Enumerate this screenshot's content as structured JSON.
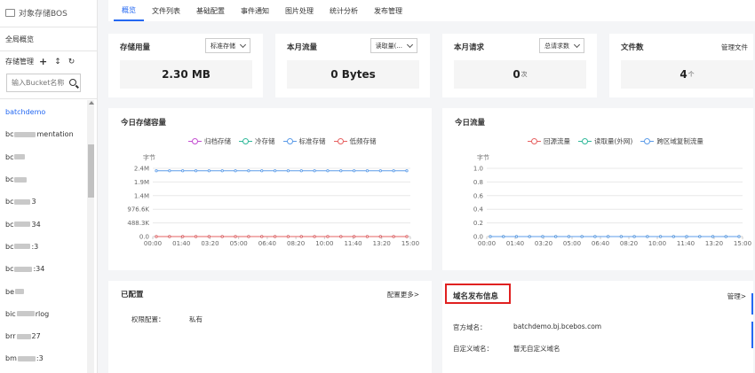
{
  "sidebar": {
    "title": "对象存储BOS",
    "overview": "全局概览",
    "manage_label": "存储管理",
    "tool_add": "+",
    "tool_sort": "↕",
    "tool_refresh": "↻",
    "search_placeholder": "输入Bucket名称",
    "buckets": [
      "batchdemo",
      "bc",
      "mentation",
      "bc",
      "bc",
      "bc",
      "3",
      "bc",
      "34",
      "bc",
      ":3",
      "bc",
      ":34",
      "be",
      "bic",
      "rlog",
      "brr",
      "27",
      "bm",
      ":3"
    ]
  },
  "tabs": [
    "概览",
    "文件列表",
    "基础配置",
    "事件通知",
    "图片处理",
    "统计分析",
    "发布管理"
  ],
  "cards": {
    "storage": {
      "title": "存储用量",
      "select": "标准存储",
      "value": "2.30 MB"
    },
    "traffic": {
      "title": "本月流量",
      "select": "读取量(...",
      "value": "0 Bytes"
    },
    "requests": {
      "title": "本月请求",
      "select": "总请求数",
      "value": "0",
      "unit": "次"
    },
    "files": {
      "title": "文件数",
      "link": "管理文件",
      "value": "4",
      "unit": "个"
    }
  },
  "storage_chart": {
    "title": "今日存储容量",
    "legend": [
      "归档存储",
      "冷存储",
      "标准存储",
      "低频存储"
    ],
    "legend_colors": [
      "#c44dd1",
      "#2fb89a",
      "#5b9be8",
      "#e66060"
    ],
    "unit_label": "字节"
  },
  "traffic_chart": {
    "title": "今日流量",
    "legend": [
      "回源流量",
      "读取量(外网)",
      "跨区域复制流量"
    ],
    "legend_colors": [
      "#e66060",
      "#2fb89a",
      "#5b9be8"
    ],
    "unit_label": "字节"
  },
  "chart_data": [
    {
      "type": "line",
      "title": "今日存储容量",
      "ylabel": "字节",
      "x": [
        "00:00",
        "01:40",
        "03:20",
        "05:00",
        "06:40",
        "08:20",
        "10:00",
        "11:40",
        "13:20",
        "15:00"
      ],
      "y_ticks": [
        "0.0",
        "488.3K",
        "976.6K",
        "1.4M",
        "1.9M",
        "2.4M"
      ],
      "ylim": [
        0,
        2500000
      ],
      "series": [
        {
          "name": "归档存储",
          "color": "#c44dd1",
          "values": [
            0,
            0,
            0,
            0,
            0,
            0,
            0,
            0,
            0,
            0,
            0,
            0,
            0,
            0,
            0,
            0,
            0,
            0,
            0,
            0
          ]
        },
        {
          "name": "冷存储",
          "color": "#2fb89a",
          "values": [
            0,
            0,
            0,
            0,
            0,
            0,
            0,
            0,
            0,
            0,
            0,
            0,
            0,
            0,
            0,
            0,
            0,
            0,
            0,
            0
          ]
        },
        {
          "name": "标准存储",
          "color": "#5b9be8",
          "values": [
            2410000,
            2410000,
            2410000,
            2410000,
            2410000,
            2410000,
            2410000,
            2410000,
            2410000,
            2410000,
            2410000,
            2410000,
            2410000,
            2410000,
            2410000,
            2410000,
            2410000,
            2410000,
            2410000,
            2410000
          ]
        },
        {
          "name": "低频存储",
          "color": "#e66060",
          "values": [
            0,
            0,
            0,
            0,
            0,
            0,
            0,
            0,
            0,
            0,
            0,
            0,
            0,
            0,
            0,
            0,
            0,
            0,
            0,
            0
          ]
        }
      ],
      "grid": true,
      "legend": "top-center"
    },
    {
      "type": "line",
      "title": "今日流量",
      "ylabel": "字节",
      "x": [
        "00:00",
        "01:40",
        "03:20",
        "05:00",
        "06:40",
        "08:20",
        "10:00",
        "11:40",
        "13:20",
        "15:00"
      ],
      "y_ticks": [
        "0.0",
        "0.2",
        "0.4",
        "0.6",
        "0.8",
        "1.0"
      ],
      "ylim": [
        0,
        1
      ],
      "series": [
        {
          "name": "回源流量",
          "color": "#e66060",
          "values": [
            0,
            0,
            0,
            0,
            0,
            0,
            0,
            0,
            0,
            0,
            0,
            0,
            0,
            0,
            0,
            0,
            0,
            0,
            0,
            0
          ]
        },
        {
          "name": "读取量(外网)",
          "color": "#2fb89a",
          "values": [
            0,
            0,
            0,
            0,
            0,
            0,
            0,
            0,
            0,
            0,
            0,
            0,
            0,
            0,
            0,
            0,
            0,
            0,
            0,
            0
          ]
        },
        {
          "name": "跨区域复制流量",
          "color": "#5b9be8",
          "values": [
            0,
            0,
            0,
            0,
            0,
            0,
            0,
            0,
            0,
            0,
            0,
            0,
            0,
            0,
            0,
            0,
            0,
            0,
            0,
            0
          ]
        }
      ],
      "grid": true,
      "legend": "top-center"
    }
  ],
  "config": {
    "title": "已配置",
    "link": "配置更多>",
    "perm_label": "权限配置：",
    "perm_value": "私有"
  },
  "domain": {
    "title": "域名发布信息",
    "link": "管理>",
    "official_label": "官方域名：",
    "official_value": "batchdemo.bj.bcebos.com",
    "custom_label": "自定义域名：",
    "custom_value": "暂无自定义域名"
  }
}
